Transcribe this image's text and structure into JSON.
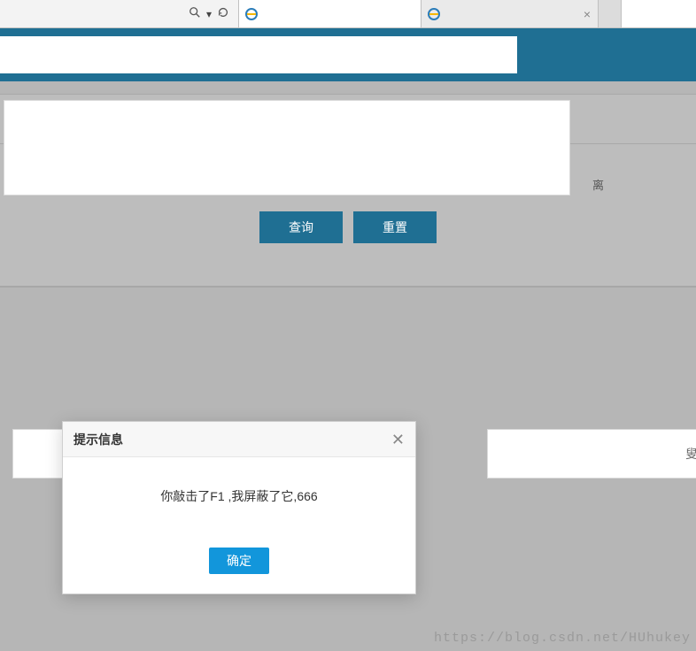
{
  "chrome": {
    "search_icon": "🔍",
    "refresh_icon": "↻",
    "dropdown_icon": "▾",
    "tabs": [
      {
        "title": ""
      },
      {
        "title": "",
        "closable": true
      }
    ]
  },
  "panel": {
    "peek_label": "离",
    "btn_query": "查询",
    "btn_reset": "重置"
  },
  "side_char": "叟",
  "dialog": {
    "title": "提示信息",
    "message": "你敲击了F1 ,我屏蔽了它,666",
    "ok": "确定",
    "close": "✕"
  },
  "watermark": "https://blog.csdn.net/HUhukey"
}
